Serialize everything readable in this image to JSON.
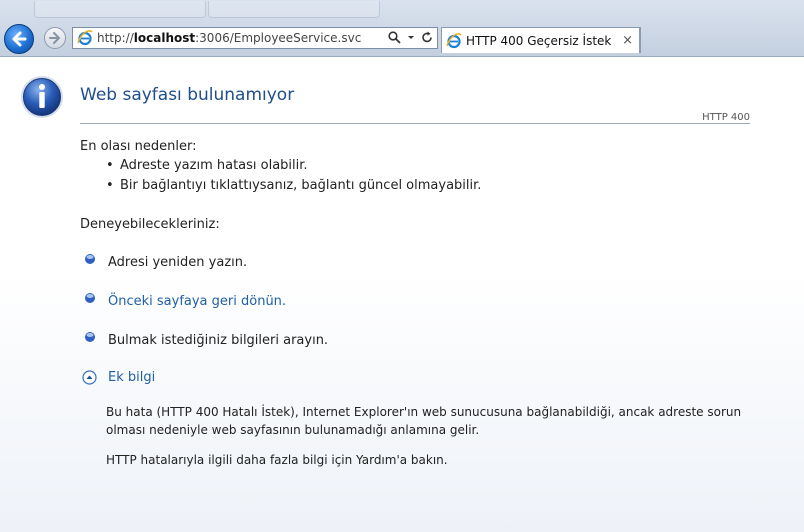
{
  "browser": {
    "url_prefix": "http://",
    "url_host": "localhost",
    "url_rest": ":3006/EmployeeService.svc",
    "tab_title": "HTTP 400 Geçersiz İstek",
    "tab_close": "×"
  },
  "page": {
    "heading": "Web sayfası bulunamıyor",
    "code": "HTTP 400",
    "causes_title": "En olası nedenler:",
    "causes": [
      "Adreste yazım hatası olabilir.",
      "Bir bağlantıyı tıklattıysanız, bağlantı güncel olmayabilir."
    ],
    "tries_title": "Deneyebilecekleriniz:",
    "actions": [
      "Adresi yeniden yazın.",
      "Önceki sayfaya geri dönün.",
      "Bulmak  istediğiniz bilgileri arayın."
    ],
    "more_info": "Ek bilgi",
    "details": [
      "Bu hata (HTTP 400 Hatalı İstek), Internet Explorer'ın web sunucusuna bağlanabildiği, ancak adreste sorun olması nedeniyle web sayfasının bulunamadığı anlamına gelir.",
      "HTTP hatalarıyla ilgili daha fazla bilgi için Yardım'a bakın."
    ]
  },
  "colors": {
    "heading": "#1f4e8c",
    "link": "#1f5fa6",
    "chrome": "#cdd7e5"
  }
}
